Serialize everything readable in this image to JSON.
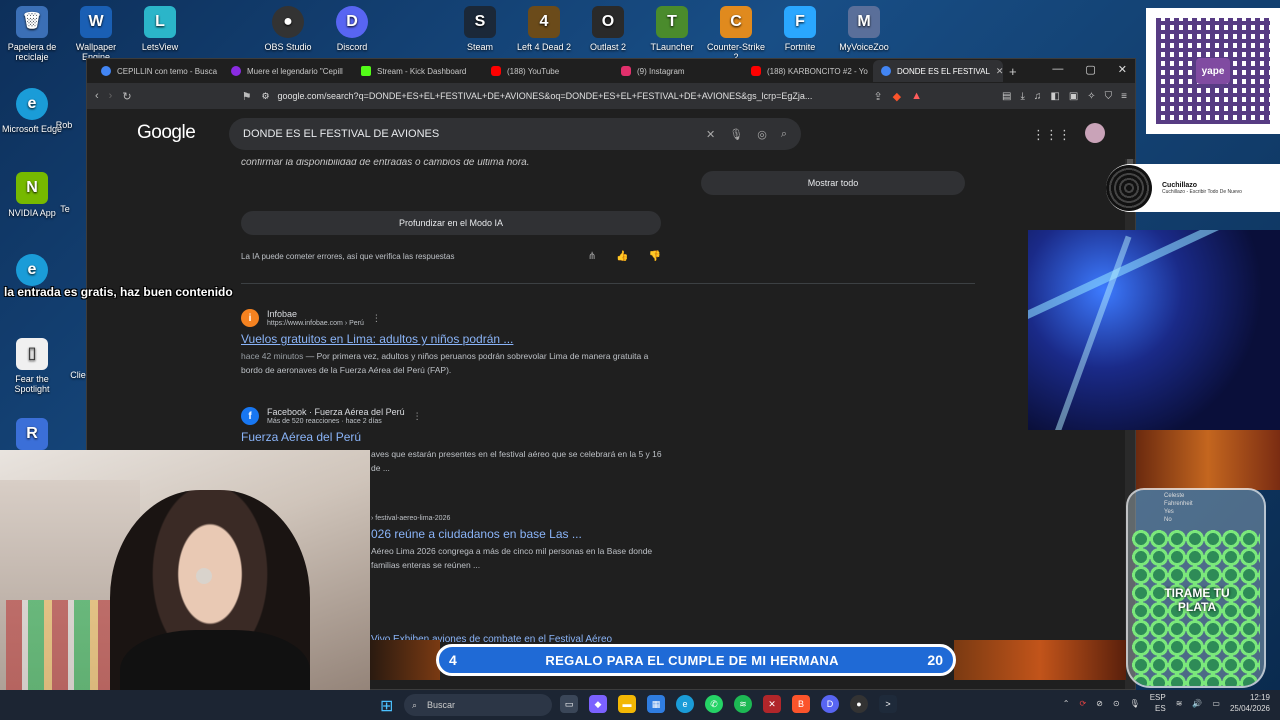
{
  "desktop": {
    "icons": [
      {
        "label": "Papelera de reciclaje",
        "color": "#3b6fb6",
        "glyph": "🗑"
      },
      {
        "label": "Wallpaper Engine",
        "color": "#1a5fb4",
        "glyph": "W"
      },
      {
        "label": "LetsView",
        "color": "#2bb5c9",
        "glyph": "L"
      },
      {
        "label": "OBS Studio",
        "color": "#333333",
        "glyph": "●"
      },
      {
        "label": "Discord",
        "color": "#5865f2",
        "glyph": "D"
      },
      {
        "label": "Steam",
        "color": "#1b2838",
        "glyph": "S"
      },
      {
        "label": "Left 4 Dead 2",
        "color": "#6b4b1a",
        "glyph": "4"
      },
      {
        "label": "Outlast 2",
        "color": "#2a2a2a",
        "glyph": "O"
      },
      {
        "label": "TLauncher",
        "color": "#4a8b2c",
        "glyph": "T"
      },
      {
        "label": "Counter-Strike 2",
        "color": "#e08a1e",
        "glyph": "C"
      },
      {
        "label": "Fortnite",
        "color": "#2aa7ff",
        "glyph": "F"
      },
      {
        "label": "MyVoiceZoo",
        "color": "#5a6f9a",
        "glyph": "M"
      },
      {
        "label": "Microsoft Edge",
        "color": "#1a9cd8",
        "glyph": "e"
      },
      {
        "label": "Rob",
        "color": "#333333",
        "glyph": ""
      },
      {
        "label": "NVIDIA App",
        "color": "#76b900",
        "glyph": "N"
      },
      {
        "label": "Te",
        "color": "#333333",
        "glyph": ""
      },
      {
        "label": "Fear the Spotlight",
        "color": "#f0f0f0",
        "glyph": "📄"
      },
      {
        "label": "Clie",
        "color": "#333333",
        "glyph": ""
      },
      {
        "label": "",
        "color": "#1a9cd8",
        "glyph": "e"
      },
      {
        "label": "",
        "color": "#3b6fd8",
        "glyph": "R"
      }
    ]
  },
  "browser": {
    "tabs": [
      {
        "label": "CEPILLIN con temo - Busca",
        "color": "#4285f4"
      },
      {
        "label": "Muere el legendario \"Cepill",
        "color": "#8a2be2"
      },
      {
        "label": "Stream - Kick Dashboard",
        "color": "#53fc18"
      },
      {
        "label": "(188) YouTube",
        "color": "#ff0000"
      },
      {
        "label": "(9) Instagram",
        "color": "#e1306c"
      },
      {
        "label": "(188) KARBONCITO #2 - Yo",
        "color": "#ff0000"
      },
      {
        "label": "DONDE ES EL FESTIVAL",
        "color": "#4285f4",
        "active": true
      }
    ],
    "url": "google.com/search?q=DONDE+ES+EL+FESTIVAL+DE+AVIONES&oq=DONDE+ES+EL+FESTIVAL+DE+AVIONES&gs_lcrp=EgZja..."
  },
  "google": {
    "logo": "Google",
    "query": "DONDE ES EL FESTIVAL DE AVIONES",
    "ai_tail": "confirmar la disponibilidad de entradas o cambios de última hora.",
    "deeper_button": "Profundizar en el Modo IA",
    "ai_note": "La IA puede cometer errores, así que verifica las respuestas",
    "show_all": "Mostrar todo",
    "results": [
      {
        "site": "Infobae",
        "url": "https://www.infobae.com › Perú",
        "fav_color": "#f58220",
        "fav_glyph": "i",
        "title": "Vuelos gratuitos en Lima: adultos y niños podrán ...",
        "date": "hace 42 minutos",
        "snippet": "— Por primera vez, adultos y niños peruanos podrán sobrevolar Lima de manera gratuita a bordo de aeronaves de la Fuerza Aérea del Perú (FAP)."
      },
      {
        "site": "Facebook · Fuerza Aérea del Perú",
        "url": "Más de 520 reacciones · hace 2 días",
        "fav_color": "#1877f2",
        "fav_glyph": "f",
        "title": "Fuerza Aérea del Perú",
        "date": "",
        "snippet": "aves que estarán presentes en el festival aéreo que se celebrará en la 5 y 16 de ..."
      },
      {
        "site": "",
        "url": "› festival-aereo-lima-2026",
        "fav_color": "#1f1f1f",
        "fav_glyph": "",
        "title": "026 reúne a ciudadanos en base Las ...",
        "date": "",
        "snippet": "Aéreo Lima 2026 congrega a más de cinco mil personas en la Base donde familias enteras se reúnen ..."
      },
      {
        "site": "",
        "url": "",
        "fav_color": "#1f1f1f",
        "fav_glyph": "",
        "title": "Vivo Exhiben aviones de combate en el Festival Aéreo",
        "date": "",
        "snippet": ""
      }
    ]
  },
  "overlay": {
    "subtitle": "la entrada es gratis, haz buen contenido",
    "song_title": "Cuchillazo",
    "song_sub": "Cuchillazo - Escribir Todo De Nuevo",
    "qr_brand": "yape",
    "goal_left": "4",
    "goal_text": "REGALO PARA EL CUMPLE DE MI HERMANA",
    "goal_right": "20",
    "jar_label": "TIRAME TU PLATA",
    "jar_tiny": [
      "Celeste",
      "Fahrenheit",
      "Yes",
      "No"
    ]
  },
  "taskbar": {
    "search_placeholder": "Buscar",
    "lang": "ESP",
    "region": "ES",
    "time": "12:19",
    "date": "25/04/2026",
    "apps": [
      {
        "name": "task-view",
        "color": "#3a4658",
        "glyph": "▭"
      },
      {
        "name": "copilot",
        "color": "#7b61ff",
        "glyph": "◆"
      },
      {
        "name": "explorer",
        "color": "#f2b705",
        "glyph": "▬"
      },
      {
        "name": "store",
        "color": "#2f7de1",
        "glyph": "▦"
      },
      {
        "name": "edge",
        "color": "#1a9cd8",
        "glyph": "e"
      },
      {
        "name": "whatsapp",
        "color": "#25d366",
        "glyph": "✆"
      },
      {
        "name": "spotify",
        "color": "#1db954",
        "glyph": "≋"
      },
      {
        "name": "game",
        "color": "#b0262a",
        "glyph": "✕"
      },
      {
        "name": "brave",
        "color": "#fb542b",
        "glyph": "B"
      },
      {
        "name": "discord",
        "color": "#5865f2",
        "glyph": "D"
      },
      {
        "name": "obs",
        "color": "#333333",
        "glyph": "●"
      },
      {
        "name": "terminal",
        "color": "#1e2a3a",
        "glyph": ">"
      }
    ]
  }
}
